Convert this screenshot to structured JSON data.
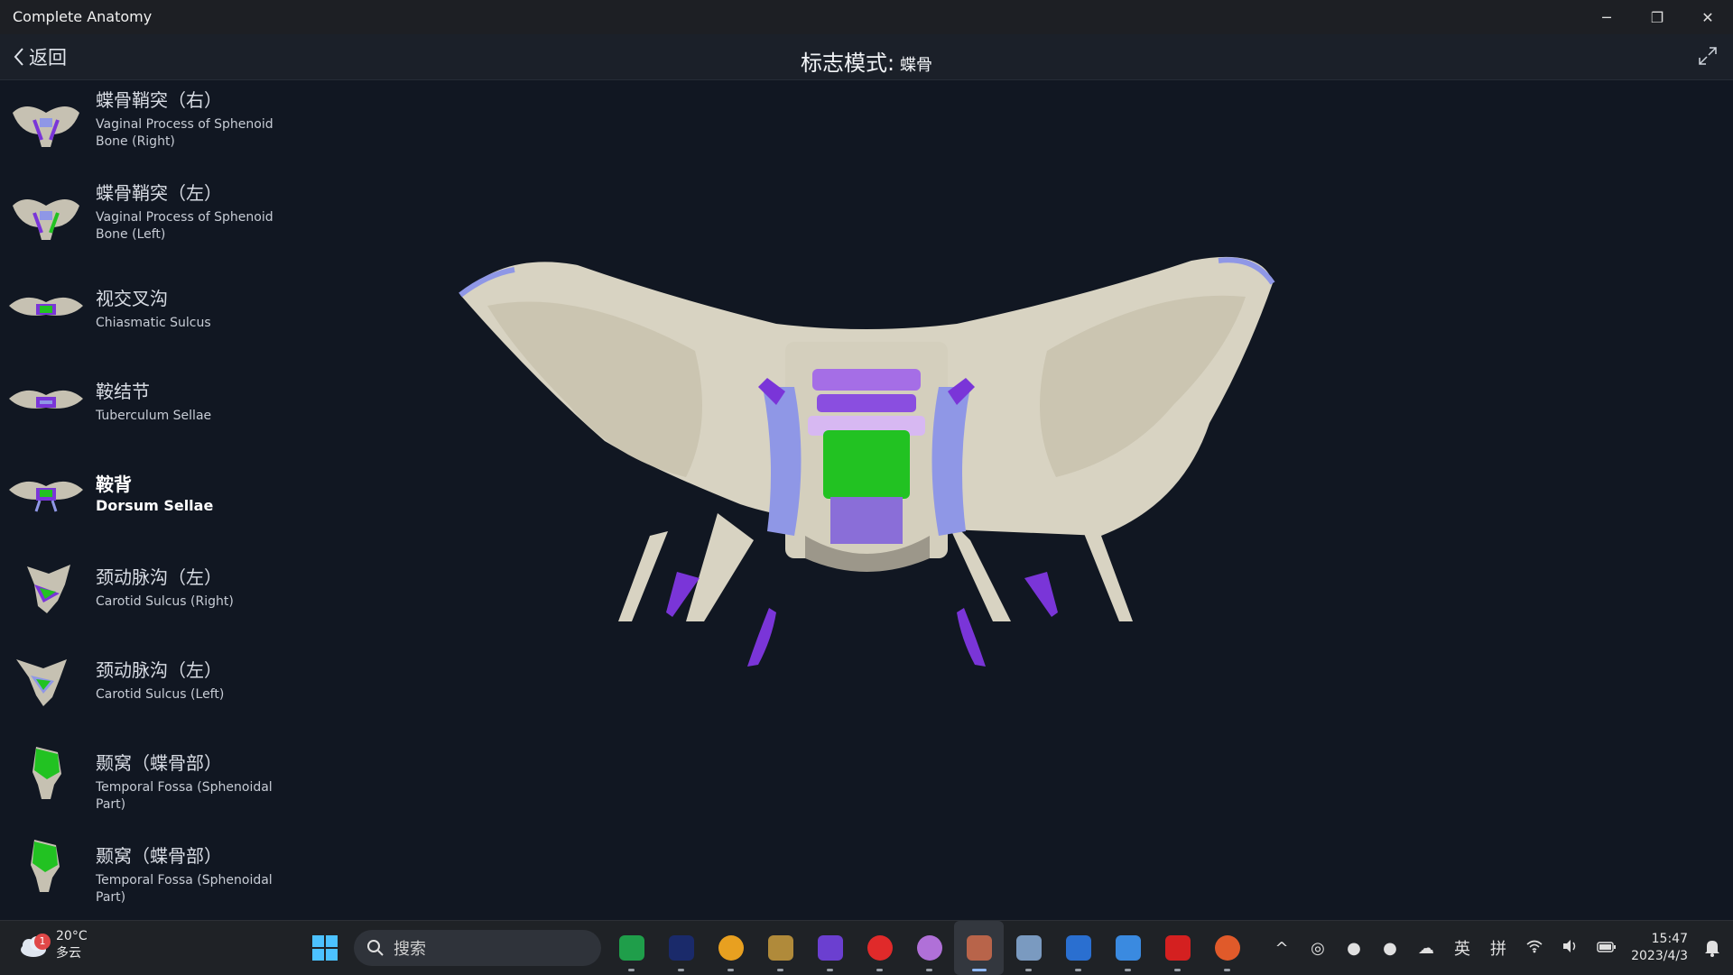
{
  "window": {
    "title": "Complete Anatomy",
    "minimize": "─",
    "restore": "❐",
    "close": "✕"
  },
  "header": {
    "back_label": "返回",
    "mode_title": "标志模式:",
    "mode_subject": "蝶骨"
  },
  "sidebar": {
    "items": [
      {
        "cn": "蝶骨鞘突（右）",
        "en": "Vaginal Process of Sphenoid Bone (Right)"
      },
      {
        "cn": "蝶骨鞘突（左）",
        "en": "Vaginal Process of Sphenoid Bone (Left)"
      },
      {
        "cn": "视交叉沟",
        "en": "Chiasmatic Sulcus"
      },
      {
        "cn": "鞍结节",
        "en": "Tuberculum Sellae"
      },
      {
        "cn": "鞍背",
        "en": "Dorsum Sellae",
        "selected": true
      },
      {
        "cn": "颈动脉沟（左）",
        "en": "Carotid Sulcus (Right)"
      },
      {
        "cn": "颈动脉沟（左）",
        "en": "Carotid Sulcus (Left)"
      },
      {
        "cn": "颞窝（蝶骨部）",
        "en": "Temporal Fossa (Sphenoidal Part)"
      },
      {
        "cn": "颞窝（蝶骨部）",
        "en": "Temporal Fossa (Sphenoidal Part)"
      }
    ]
  },
  "colors": {
    "highlight": "#22c222",
    "landmark_blue": "#8f97e6",
    "landmark_purple": "#7a35d8",
    "bone": "#d8d3c2"
  },
  "taskbar": {
    "weather": {
      "badge": "1",
      "temp": "20°C",
      "condition": "多云"
    },
    "search_placeholder": "搜索",
    "apps": [
      "spreadsheet-app",
      "game-app",
      "g-app",
      "league-app",
      "crystal-app",
      "netease-music-app",
      "orb-app",
      "complete-anatomy-app",
      "robot-app",
      "monitor-app",
      "editor-app",
      "acrobat-app",
      "pinwheel-app"
    ],
    "tray": {
      "chevron": "^",
      "ime_lang": "英",
      "ime_mode": "拼"
    },
    "time": "15:47",
    "date": "2023/4/3"
  }
}
